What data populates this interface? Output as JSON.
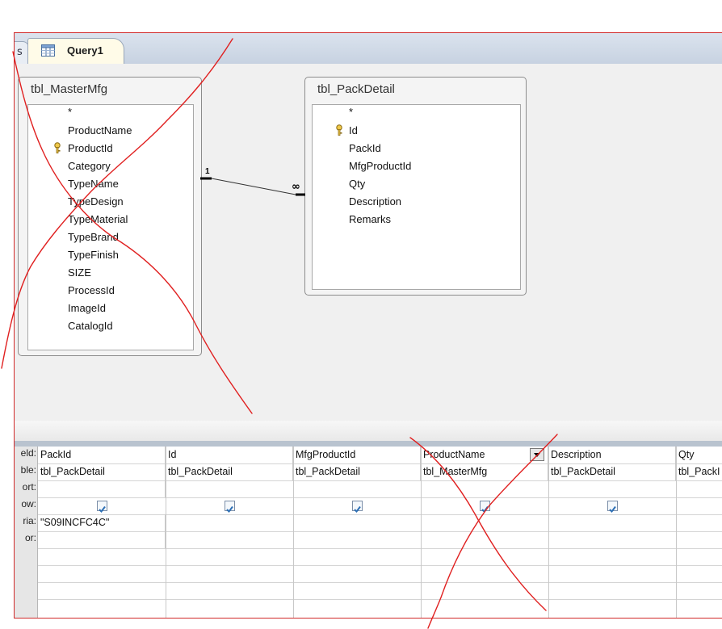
{
  "tabs": {
    "previous_tab_label": "s",
    "active_tab_label": "Query1"
  },
  "tables": [
    {
      "name": "tbl_MasterMfg",
      "fields": [
        "*",
        "ProductName",
        "ProductId",
        "Category",
        "TypeName",
        "TypeDesign",
        "TypeMaterial",
        "TypeBrand",
        "TypeFinish",
        "SIZE",
        "ProcessId",
        "ImageId",
        "CatalogId"
      ],
      "primary_key": "ProductId"
    },
    {
      "name": "tbl_PackDetail",
      "fields": [
        "*",
        "Id",
        "PackId",
        "MfgProductId",
        "Qty",
        "Description",
        "Remarks"
      ],
      "primary_key": "Id"
    }
  ],
  "relationship": {
    "one_side_label": "1",
    "many_side_label": "∞"
  },
  "grid": {
    "row_headers": [
      "eld:",
      "ble:",
      "ort:",
      "ow:",
      "ria:",
      "or:"
    ],
    "columns": [
      {
        "field": "PackId",
        "table": "tbl_PackDetail",
        "sort": "",
        "show": true,
        "criteria": "\"S09INCFC4C\"",
        "or": ""
      },
      {
        "field": "Id",
        "table": "tbl_PackDetail",
        "sort": "",
        "show": true,
        "criteria": "",
        "or": ""
      },
      {
        "field": "MfgProductId",
        "table": "tbl_PackDetail",
        "sort": "",
        "show": true,
        "criteria": "",
        "or": ""
      },
      {
        "field": "ProductName",
        "table": "tbl_MasterMfg",
        "sort": "",
        "show": true,
        "criteria": "",
        "or": ""
      },
      {
        "field": "Description",
        "table": "tbl_PackDetail",
        "sort": "",
        "show": true,
        "criteria": "",
        "or": ""
      },
      {
        "field": "Qty",
        "table": "tbl_PackI",
        "sort": "",
        "show": false,
        "criteria": "",
        "or": ""
      }
    ]
  },
  "colors": {
    "annotation": "#e02020",
    "frame_border": "#d12a2a",
    "tab_active_bg": "#fffbe8",
    "checkbox_check": "#2d6fb5"
  },
  "icons": {
    "tab_icon": "query-datasheet-icon",
    "key_icon": "primary-key-icon",
    "dropdown_icon": "dropdown-arrow-icon",
    "checkbox_icon": "checkbox-checked-icon"
  }
}
